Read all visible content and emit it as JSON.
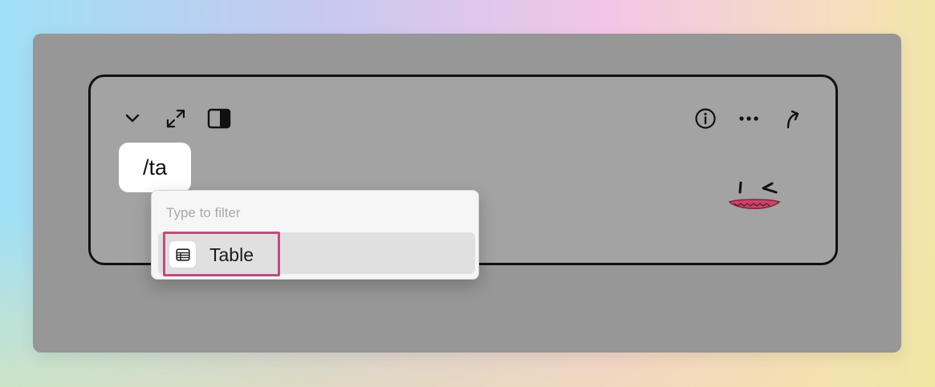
{
  "editor": {
    "slash_command": "/ta"
  },
  "toolbar": {
    "left_icons": [
      "chevron-down-icon",
      "expand-icon",
      "panel-toggle-icon"
    ],
    "right_icons": [
      "info-icon",
      "more-icon",
      "share-arrow-icon"
    ]
  },
  "command_menu": {
    "filter_placeholder": "Type to filter",
    "items": [
      {
        "label": "Table",
        "icon": "table-icon",
        "highlighted": true
      }
    ]
  },
  "colors": {
    "card_background": "#979797",
    "frame_background": "#a3a3a3",
    "highlight_border": "#c04b7e",
    "menu_background": "#f6f6f6"
  }
}
